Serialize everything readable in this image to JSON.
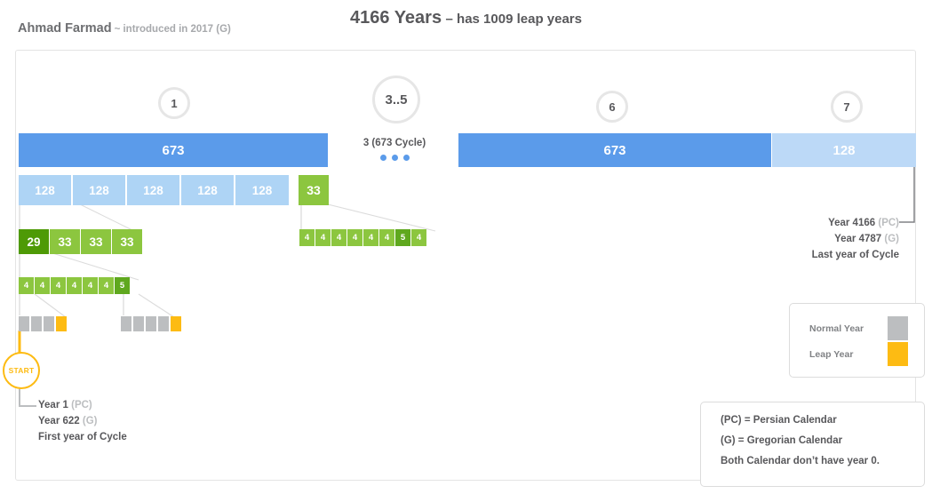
{
  "header": {
    "author": "Ahmad Farmad",
    "author_note": "~ introduced in 2017 (G)",
    "title_main": "4166 Years",
    "title_sub": "– has 1009 leap years"
  },
  "circles": [
    {
      "label": "1"
    },
    {
      "label": "3..5"
    },
    {
      "label": "6"
    },
    {
      "label": "7"
    }
  ],
  "bars": [
    {
      "label": "673",
      "tone": "dark"
    },
    {
      "label": "673",
      "tone": "dark"
    },
    {
      "label": "128",
      "tone": "light"
    }
  ],
  "middle": {
    "cycle_label": "3 (673 Cycle)",
    "dots": 3
  },
  "row_128": {
    "boxes": [
      "128",
      "128",
      "128",
      "128",
      "128"
    ],
    "tail": "33"
  },
  "row_33": {
    "boxes": [
      "29",
      "33",
      "33",
      "33"
    ]
  },
  "row_4_left": {
    "boxes": [
      "4",
      "4",
      "4",
      "4",
      "4",
      "4",
      "5"
    ]
  },
  "row_4_right": {
    "boxes": [
      "4",
      "4",
      "4",
      "4",
      "4",
      "4",
      "5",
      "4"
    ]
  },
  "year_group_left": {
    "normal": 3,
    "leap": 1
  },
  "year_group_right": {
    "normal": 4,
    "leap": 1
  },
  "start": {
    "label": "START",
    "year_pc": "Year 1",
    "tag_pc": "(PC)",
    "year_g": "Year 622",
    "tag_g": "(G)",
    "note": "First year of Cycle"
  },
  "end": {
    "year_pc": "Year 4166",
    "tag_pc": "(PC)",
    "year_g": "Year 4787",
    "tag_g": "(G)",
    "note": "Last year of Cycle"
  },
  "legend": {
    "normal_label": "Normal Year",
    "leap_label": "Leap Year"
  },
  "info": {
    "line1": "(PC) = Persian Calendar",
    "line2": "(G) = Gregorian Calendar",
    "line3": "Both Calendar don’t have year 0."
  },
  "colors": {
    "bar_dark": "#5b9bea",
    "bar_light": "#bcd9f7",
    "box_128": "#aed4f5",
    "green": "#8cc63f",
    "green_dark": "#5fa81e",
    "green_darkest": "#4e9a06",
    "leap": "#fdbb13",
    "normal": "#bcbec0",
    "text": "#58585b",
    "muted": "#bcbec0"
  }
}
